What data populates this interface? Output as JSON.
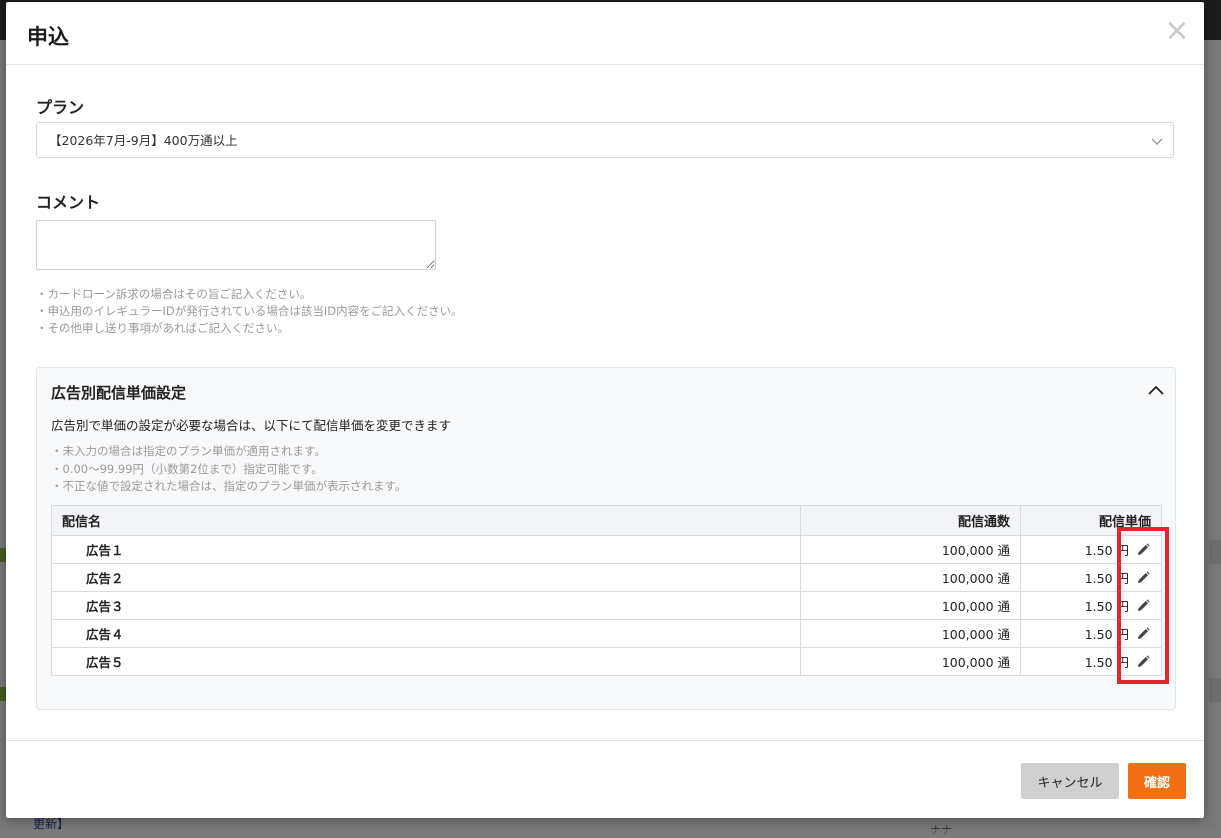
{
  "background": {
    "link_text": "更新】",
    "right_text": "ナナ"
  },
  "modal": {
    "title": "申込",
    "close_icon": "close-icon",
    "plan": {
      "label": "プラン",
      "selected": "【2026年7月-9月】400万通以上"
    },
    "comment": {
      "label": "コメント",
      "value": "",
      "notes": [
        "・カードローン訴求の場合はその旨ご記入ください。",
        "・申込用のイレギュラーIDが発行されている場合は該当ID内容をご記入ください。",
        "・その他申し送り事項があればご記入ください。"
      ]
    },
    "ad_price": {
      "title": "広告別配信単価設定",
      "description": "広告別で単価の設定が必要な場合は、以下にて配信単価を変更できます",
      "notes": [
        "・未入力の場合は指定のプラン単価が適用されます。",
        "・0.00〜99.99円（小数第2位まで）指定可能です。",
        "・不正な値で設定された場合は、指定のプラン単価が表示されます。"
      ],
      "columns": [
        "配信名",
        "配信通数",
        "配信単価"
      ],
      "rows": [
        {
          "name": "広告１",
          "count": "100,000 通",
          "price": "1.50 円"
        },
        {
          "name": "広告２",
          "count": "100,000 通",
          "price": "1.50 円"
        },
        {
          "name": "広告３",
          "count": "100,000 通",
          "price": "1.50 円"
        },
        {
          "name": "広告４",
          "count": "100,000 通",
          "price": "1.50 円"
        },
        {
          "name": "広告５",
          "count": "100,000 通",
          "price": "1.50 円"
        }
      ]
    },
    "footer": {
      "cancel_label": "キャンセル",
      "confirm_label": "確認"
    }
  },
  "colors": {
    "accent": "#f36f14",
    "highlight": "#e3262e",
    "cancel_bg": "#d0d0d0"
  }
}
